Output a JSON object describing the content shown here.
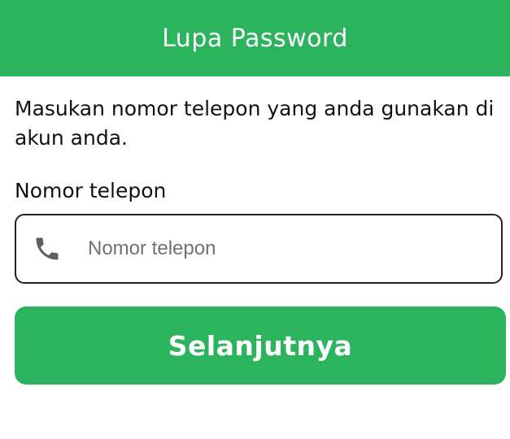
{
  "header": {
    "title": "Lupa Password"
  },
  "colors": {
    "accent": "#2BB35E",
    "text": "#111111",
    "input_border": "#222222",
    "icon": "#5f5f5f"
  },
  "form": {
    "instruction": "Masukan nomor telepon yang anda gunakan di akun anda.",
    "phone_label": "Nomor telepon",
    "phone_placeholder": "Nomor telepon",
    "phone_value": "",
    "phone_icon": "phone-icon",
    "next_button_label": "Selanjutnya"
  }
}
